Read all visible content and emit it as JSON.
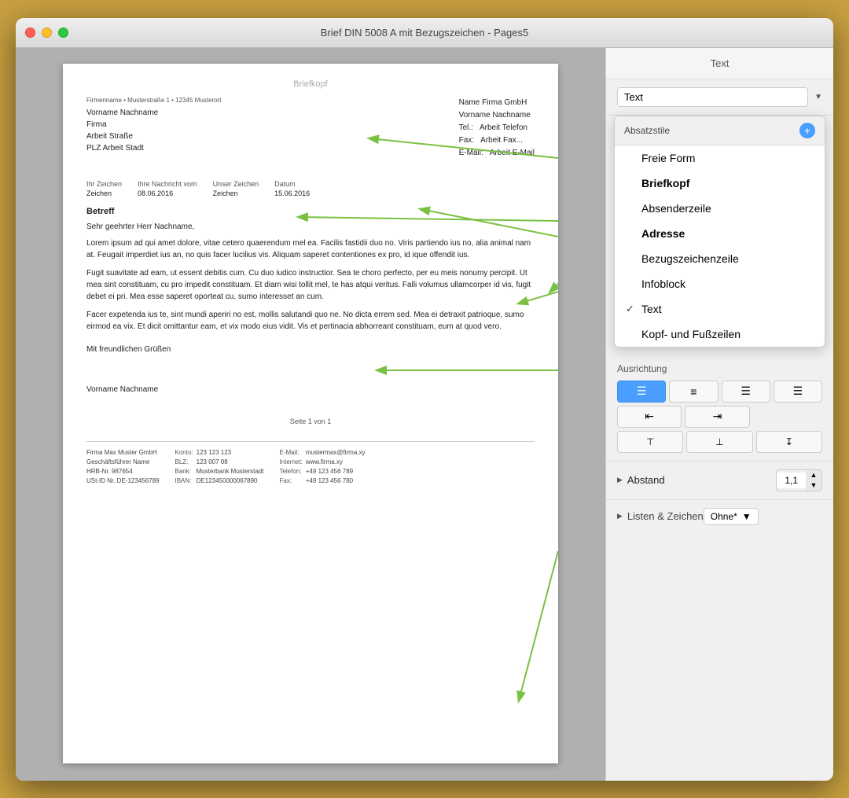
{
  "window": {
    "title": "Brief DIN 5008 A mit Bezugszeichen - Pages5"
  },
  "sidebar": {
    "header": "Text",
    "style_label": "Text",
    "popup": {
      "header": "Absatzstile",
      "add_label": "+",
      "items": [
        {
          "label": "Freie Form",
          "bold": false,
          "checked": false
        },
        {
          "label": "Briefkopf",
          "bold": true,
          "checked": false
        },
        {
          "label": "Absenderzeile",
          "bold": false,
          "checked": false
        },
        {
          "label": "Adresse",
          "bold": true,
          "checked": false
        },
        {
          "label": "Bezugszeichenzeile",
          "bold": false,
          "checked": false
        },
        {
          "label": "Infoblock",
          "bold": false,
          "checked": false
        },
        {
          "label": "Text",
          "bold": false,
          "checked": true
        },
        {
          "label": "Kopf- und Fußzeilen",
          "bold": false,
          "checked": false
        }
      ]
    },
    "ausrichtung": "Ausrichtung",
    "align_buttons": [
      "≡",
      "≡",
      "≡",
      "≡"
    ],
    "abstand_label": "Abstand",
    "abstand_value": "1,1",
    "listen_label": "Listen & Zeichen",
    "listen_value": "Ohne*"
  },
  "document": {
    "briefkopf": "Briefkopf",
    "sender_line": "Firmenname • Musterstraße 1 • 12345 Musterort",
    "recipient": {
      "name": "Vorname Nachname",
      "firma": "Firma",
      "strasse": "Arbeit Straße",
      "plz_ort": "PLZ Arbeit Stadt"
    },
    "contact_right": {
      "company": "Name Firma GmbH",
      "name": "Vorname Nachname",
      "tel_label": "Tel.:",
      "tel": "Arbeit Telefon",
      "fax_label": "Fax:",
      "fax": "Arbeit Fax...",
      "email_label": "E-Mail:",
      "email": "Arbeit E-Mail"
    },
    "bezugszeile": {
      "ihr_zeichen_label": "Ihr Zeichen",
      "ihr_zeichen": "Zeichen",
      "nachricht_label": "Ihre Nachricht vom",
      "nachricht": "08.06.2016",
      "unser_zeichen_label": "Unser Zeichen",
      "unser_zeichen": "Zeichen",
      "datum_label": "Datum",
      "datum": "15.06.2016"
    },
    "betreff": "Betreff",
    "salutation": "Sehr geehrter Herr Nachname,",
    "paragraphs": [
      "Lorem ipsum ad qui amet dolore, vitae cetero quaerendum mel ea. Facilis fastidii duo no. Viris partiendo ius no, alia animal nam at. Feugait imperdiet ius an, no quis facer lucilius vis. Aliquam saperet contentiones ex pro, id ique offendit ius.",
      "Fugit suavitate ad eam, ut essent debitis cum. Cu duo iudico instructior. Sea te choro perfecto, per eu meis nonumy percipit. Ut mea sint constituam, cu pro impedit constituam. Et diam wisi tollit mel, te has atqui veritus. Falli volumus ullamcorper id vis, fugit debet ei pri. Mea esse saperet oporteat cu, sumo interesset an cum.",
      "Facer expetenda ius te, sint mundi aperiri no est, mollis salutandi quo ne. No dicta errem sed. Mea ei detraxit patrioque, sumo eirmod ea vix. Et dicit omittantur eam, et vix modo eius vidit. Vis et pertinacia abhorreant constituam, eum at quod vero."
    ],
    "closing": "Mit freundlichen Grüßen",
    "signature": "Vorname Nachname",
    "page_number": "Seite 1 von 1",
    "footer": {
      "col1": "Firma Max Muster GmbH\nGeschäftsführer Name\nHRB-Nr. 987654\nUSt-ID Nr. DE-123456789",
      "col2_label": "Konto:\nBLZ:\nBank:\nIBAN:",
      "col2_value": "123 123 123\n123 007 08\nMusterbank Musterstadt\nDE123450000067890",
      "col3_label": "E-Mail:\nInternet:\nTelefon:\nFax:",
      "col3_value": "mustermax@firma.xy\nwww.firma.xy\n+49 123 456 789\n+49 123 456 780"
    }
  }
}
